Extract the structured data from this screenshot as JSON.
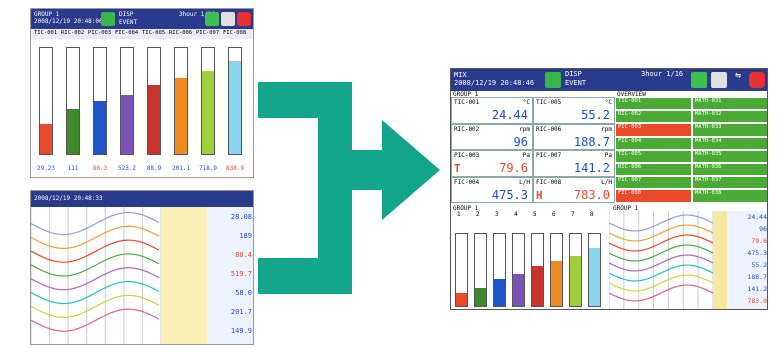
{
  "colors": {
    "accent": "#12a58a",
    "header": "#2a3a8c",
    "green": "#43a82b",
    "red": "#e84a2a",
    "blue": "#1f4fd0"
  },
  "left_top": {
    "title": "GROUP 1\n2008/12/19 20:48:06",
    "disp": "DISP",
    "event": "EVENT",
    "hour": "3hour 1/16",
    "tags": [
      "TIC-001",
      "RIC-002",
      "PIC-003",
      "FIC-004",
      "TIC-005",
      "RIC-006",
      "PIC-007",
      "FIC-008"
    ],
    "levels": [
      0.28,
      0.42,
      0.5,
      0.56,
      0.65,
      0.72,
      0.78,
      0.88
    ],
    "fills": [
      "#e84a2a",
      "#3c8a2c",
      "#1f55c8",
      "#7b52b8",
      "#c8342f",
      "#f08a22",
      "#9fcf3a",
      "#8ad4ee"
    ],
    "values": [
      "29.23",
      "111",
      "80.3",
      "523.2",
      "88.9",
      "201.1",
      "718.9",
      "838.9"
    ]
  },
  "left_bottom": {
    "title": "2008/12/19 20:48:33",
    "panel_vals": [
      "28.08",
      "189",
      "80.4",
      "519.7",
      "58.0",
      "201.7",
      "149.9"
    ]
  },
  "main": {
    "title": "MIX\n2008/12/19 20:48:46",
    "disp": "DISP",
    "event": "EVENT",
    "hour": "3hour 1/16",
    "group_label": "GROUP 1",
    "overview_label": "OVERVIEW",
    "digital": [
      {
        "tag": "TIC-001",
        "unit": "°C",
        "val": "24.44"
      },
      {
        "tag": "TIC-005",
        "unit": "°C",
        "val": "55.2"
      },
      {
        "tag": "RIC-002",
        "unit": "rpm",
        "val": "96"
      },
      {
        "tag": "RIC-006",
        "unit": "rpm",
        "val": "188.7"
      },
      {
        "tag": "PIC-003",
        "unit": "Pa",
        "val": "79.6",
        "flag": "T"
      },
      {
        "tag": "PIC-007",
        "unit": "Pa",
        "val": "141.2"
      },
      {
        "tag": "FIC-004",
        "unit": "L/H",
        "val": "475.3"
      },
      {
        "tag": "FIC-008",
        "unit": "L/H",
        "val": "783.0",
        "flag": "H"
      }
    ],
    "overview": [
      {
        "a": "TIC-001",
        "b": "MATH-031",
        "alarm": false
      },
      {
        "a": "RIC-002",
        "b": "MATH-032",
        "alarm": false
      },
      {
        "a": "PIC-003",
        "b": "MATH-033",
        "alarm": true
      },
      {
        "a": "FIC-004",
        "b": "MATH-034",
        "alarm": false
      },
      {
        "a": "TIC-005",
        "b": "MATH-035",
        "alarm": false
      },
      {
        "a": "RIC-006",
        "b": "MATH-036",
        "alarm": false
      },
      {
        "a": "PIC-007",
        "b": "MATH-037",
        "alarm": false
      },
      {
        "a": "FIC-008",
        "b": "MATH-038",
        "alarm": true
      }
    ],
    "bar_nums": [
      "1",
      "2",
      "3",
      "4",
      "5",
      "6",
      "7",
      "8"
    ],
    "bar_levels": [
      0.18,
      0.25,
      0.38,
      0.45,
      0.55,
      0.62,
      0.7,
      0.8
    ],
    "trend_vals": [
      "24.44",
      "96",
      "79.6",
      "475.3",
      "55.2",
      "188.7",
      "141.2",
      "783.0"
    ]
  }
}
